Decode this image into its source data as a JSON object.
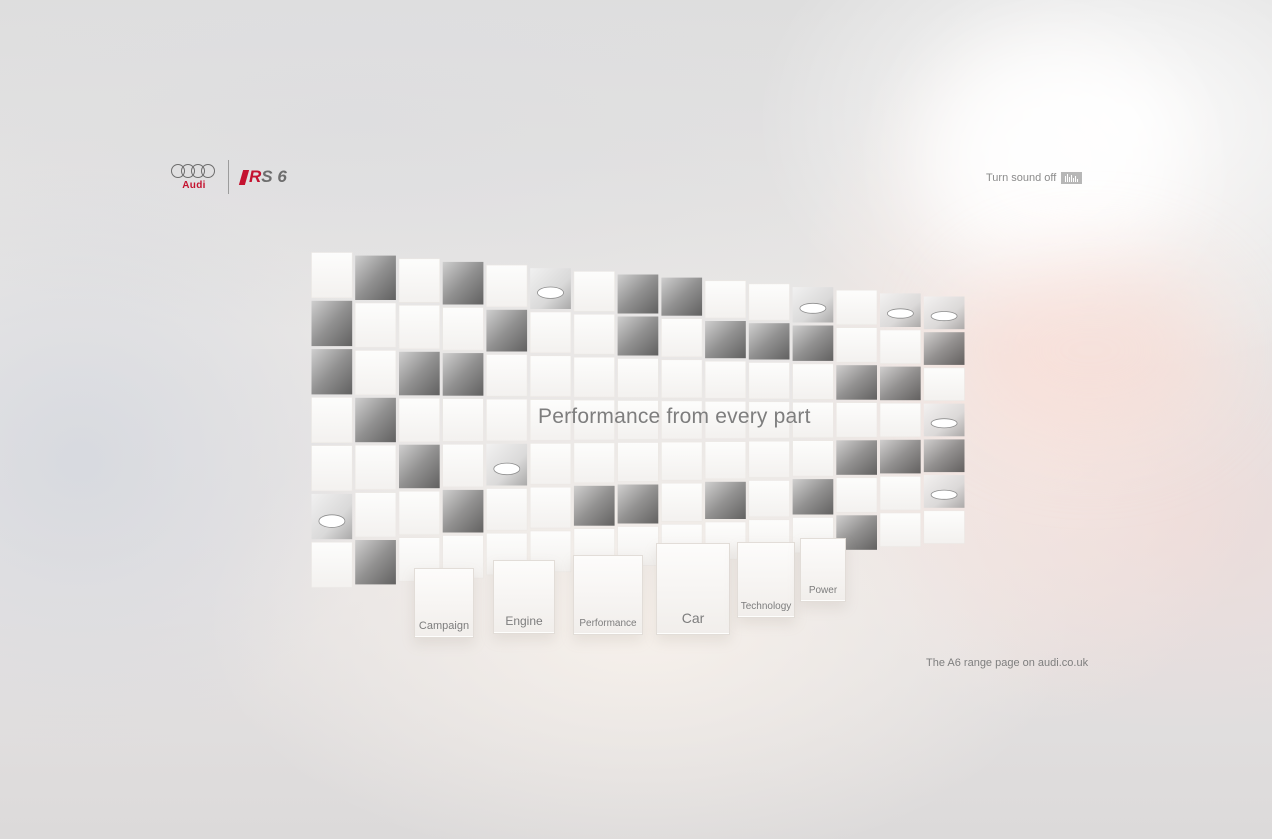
{
  "brand": {
    "audi_word": "Audi",
    "model_badge_r": "R",
    "model_badge_text": "S 6"
  },
  "sound": {
    "label": "Turn sound off",
    "icon": "equalizer-icon"
  },
  "headline": "Performance from every part",
  "nav": [
    {
      "label": "Campaign"
    },
    {
      "label": "Engine"
    },
    {
      "label": "Performance"
    },
    {
      "label": "Car"
    },
    {
      "label": "Technology"
    },
    {
      "label": "Power"
    }
  ],
  "footer": {
    "range_link": "The A6 range page on audi.co.uk"
  },
  "colors": {
    "brand_red": "#c4122f",
    "text_gray": "#7e7e7e",
    "tile_white": "#fbfaf8"
  }
}
